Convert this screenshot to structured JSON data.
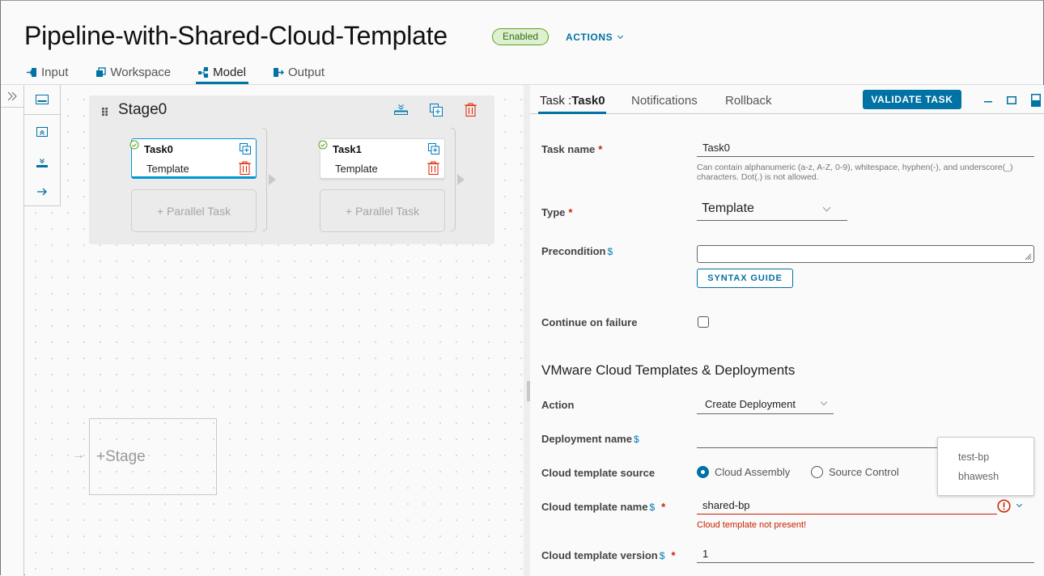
{
  "header": {
    "title": "Pipeline-with-Shared-Cloud-Template",
    "status_badge": "Enabled",
    "actions_label": "ACTIONS"
  },
  "tabs": [
    {
      "label": "Input",
      "icon": "input-icon",
      "active": false
    },
    {
      "label": "Workspace",
      "icon": "workspace-icon",
      "active": false
    },
    {
      "label": "Model",
      "icon": "model-icon",
      "active": true
    },
    {
      "label": "Output",
      "icon": "output-icon",
      "active": false
    }
  ],
  "rail": {
    "toggle_icon": "expand-icon"
  },
  "toolbox": [
    "stage-icon",
    "collapse-icon",
    "download-icon",
    "arrow-right-icon"
  ],
  "canvas": {
    "stage": {
      "name": "Stage0",
      "tasks": [
        {
          "name": "Task0",
          "type": "Template",
          "selected": true,
          "status": "valid"
        },
        {
          "name": "Task1",
          "type": "Template",
          "selected": false,
          "status": "valid"
        }
      ],
      "parallel_label": "+ Parallel Task"
    },
    "add_stage_label": "+Stage",
    "add_stage_arrow": "→"
  },
  "panel": {
    "tabs": [
      {
        "label_prefix": "Task :",
        "label_bold": "Task0",
        "active": true
      },
      {
        "label": "Notifications",
        "active": false
      },
      {
        "label": "Rollback",
        "active": false
      }
    ],
    "validate_label": "VALIDATE TASK",
    "fields": {
      "task_name": {
        "label": "Task name",
        "required": "*",
        "value": "Task0",
        "hint": "Can contain alphanumeric (a-z, A-Z, 0-9), whitespace, hyphen(-), and underscore(_) characters. Dot(.) is not allowed."
      },
      "type": {
        "label": "Type",
        "required": "*",
        "value": "Template"
      },
      "precondition": {
        "label": "Precondition",
        "dollar": "$",
        "value": "",
        "syntax_label": "SYNTAX GUIDE"
      },
      "continue_on_failure": {
        "label": "Continue on failure",
        "checked": false
      }
    },
    "section_title": "VMware Cloud Templates & Deployments",
    "section_fields": {
      "action": {
        "label": "Action",
        "value": "Create Deployment"
      },
      "deployment_name": {
        "label": "Deployment name",
        "dollar": "$",
        "value": ""
      },
      "template_source": {
        "label": "Cloud template source",
        "options": [
          "Cloud Assembly",
          "Source Control"
        ],
        "selected": "Cloud Assembly"
      },
      "template_name": {
        "label": "Cloud template name",
        "dollar": "$",
        "required": "*",
        "value": "shared-bp",
        "error": "Cloud template not present!"
      },
      "template_version": {
        "label": "Cloud template version",
        "dollar": "$",
        "required": "*",
        "value": "1"
      }
    },
    "dropdown_options": [
      "test-bp",
      "bhawesh"
    ]
  },
  "colors": {
    "accent": "#0072a3",
    "error": "#c92100",
    "success": "#5aa220",
    "delete": "#e12200"
  }
}
